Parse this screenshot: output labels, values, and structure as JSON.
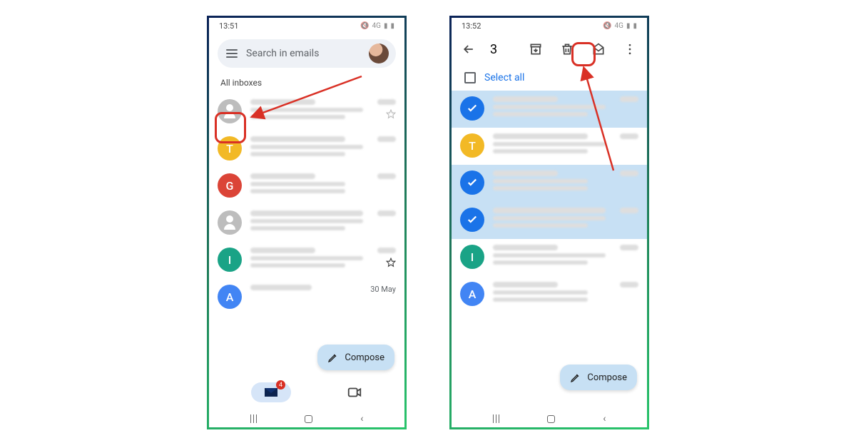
{
  "status": {
    "time_left": "13:51",
    "time_right": "13:52",
    "signal": "4G",
    "icons": [
      "vibrate",
      "4G",
      "signal",
      "battery"
    ]
  },
  "left": {
    "search_placeholder": "Search in emails",
    "section": "All inboxes",
    "compose": "Compose",
    "mail_badge": "4",
    "date_last": "30 May",
    "rows": [
      {
        "badge_type": "person",
        "letter": ""
      },
      {
        "badge_type": "letter",
        "letter": "T",
        "cls": "b-amber"
      },
      {
        "badge_type": "letter",
        "letter": "G",
        "cls": "b-red"
      },
      {
        "badge_type": "person",
        "letter": "",
        "cls": "b-grey"
      },
      {
        "badge_type": "letter",
        "letter": "I",
        "cls": "b-teal"
      },
      {
        "badge_type": "letter",
        "letter": "A",
        "cls": "b-blue"
      }
    ]
  },
  "right": {
    "selected_count": "3",
    "select_all": "Select all",
    "compose": "Compose",
    "rows": [
      {
        "selected": true
      },
      {
        "selected": false,
        "letter": "T",
        "cls": "b-amber"
      },
      {
        "selected": true
      },
      {
        "selected": true
      },
      {
        "selected": false,
        "letter": "I",
        "cls": "b-teal"
      },
      {
        "selected": false,
        "letter": "A",
        "cls": "b-blue"
      }
    ]
  }
}
